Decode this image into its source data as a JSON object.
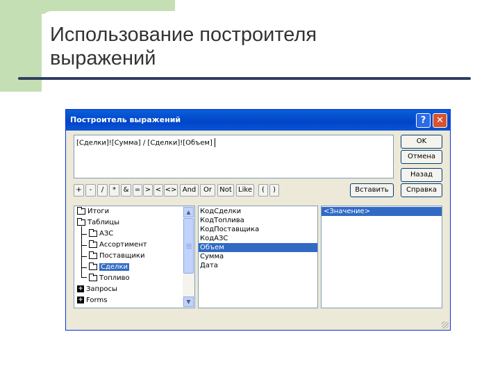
{
  "slide": {
    "title_line1": "Использование построителя",
    "title_line2": "выражений"
  },
  "dialog": {
    "title": "Построитель выражений",
    "help_glyph": "?",
    "close_glyph": "✕",
    "expression": "[Сделки]![Сумма] / [Сделки]![Объем]",
    "buttons": {
      "ok": "OK",
      "cancel": "Отмена",
      "back": "Назад",
      "help": "Справка",
      "insert": "Вставить"
    },
    "operators": [
      "+",
      "-",
      "/",
      "*",
      "&",
      "=",
      ">",
      "<",
      "<>",
      "And",
      "Or",
      "Not",
      "Like",
      "(",
      ")"
    ],
    "tree": [
      {
        "label": "Итоги",
        "kind": "folder",
        "level": 0
      },
      {
        "label": "Таблицы",
        "kind": "folder-open",
        "level": 0
      },
      {
        "label": "АЗС",
        "kind": "folder",
        "level": 1
      },
      {
        "label": "Ассортимент",
        "kind": "folder",
        "level": 1
      },
      {
        "label": "Поставщики",
        "kind": "folder",
        "level": 1
      },
      {
        "label": "Сделки",
        "kind": "folder-open",
        "level": 1,
        "selected": true
      },
      {
        "label": "Топливо",
        "kind": "folder",
        "level": 1
      },
      {
        "label": "Запросы",
        "kind": "expandable",
        "level": 0
      },
      {
        "label": "Forms",
        "kind": "expandable",
        "level": 0
      }
    ],
    "fields": [
      "КодСделки",
      "КодТоплива",
      "КодПоставщика",
      "КодАЗС",
      "Объем",
      "Сумма",
      "Дата"
    ],
    "selected_field": "Объем",
    "values": [
      "<Значение>"
    ],
    "scroll_up": "▲",
    "scroll_down": "▼"
  },
  "colors": {
    "titlebar": "#0054e3",
    "selection": "#316ac5",
    "dialog_bg": "#ece9d8",
    "slide_accent": "#c5dfb4",
    "rule": "#2e3e60"
  }
}
